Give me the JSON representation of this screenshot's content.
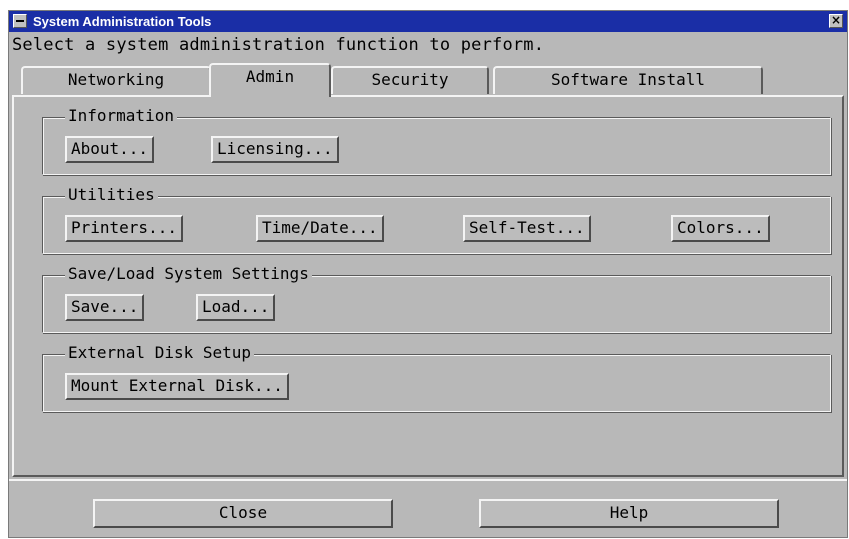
{
  "window": {
    "title": "System Administration Tools",
    "close_glyph": "×"
  },
  "instruction": "Select a system administration function to perform.",
  "tabs": [
    {
      "label": "Networking",
      "active": false
    },
    {
      "label": "Admin",
      "active": true
    },
    {
      "label": "Security",
      "active": false
    },
    {
      "label": "Software Install",
      "active": false
    }
  ],
  "groups": {
    "information": {
      "title": "Information",
      "buttons": [
        "About...",
        "Licensing..."
      ]
    },
    "utilities": {
      "title": "Utilities",
      "buttons": [
        "Printers...",
        "Time/Date...",
        "Self-Test...",
        "Colors..."
      ]
    },
    "save_load": {
      "title": "Save/Load System Settings",
      "buttons": [
        "Save...",
        "Load..."
      ]
    },
    "external_disk": {
      "title": "External Disk Setup",
      "buttons": [
        "Mount External Disk..."
      ]
    }
  },
  "footer": {
    "close_label": "Close",
    "help_label": "Help"
  },
  "colors": {
    "titlebar": "#1a2ea6",
    "face": "#b8b8b8"
  }
}
